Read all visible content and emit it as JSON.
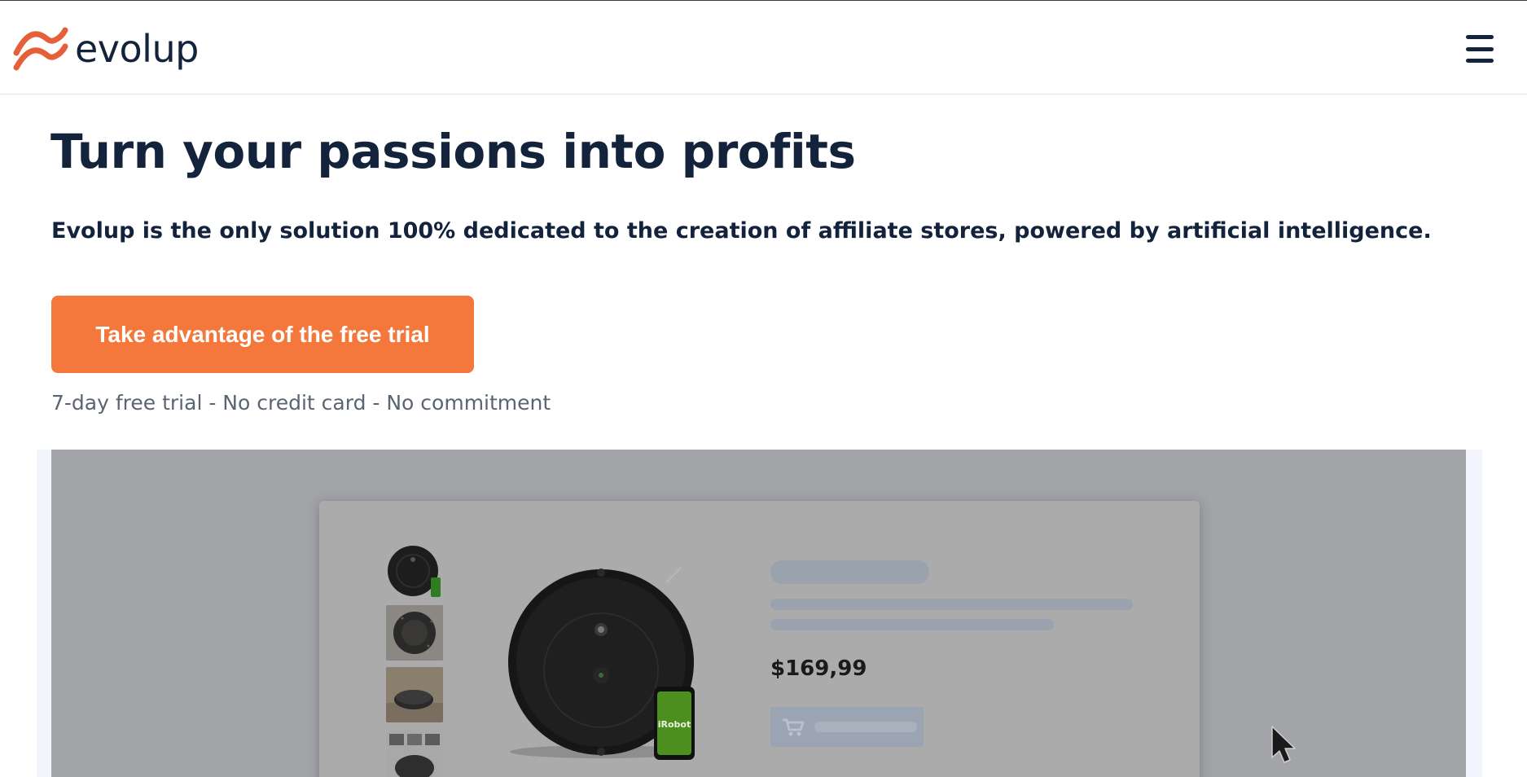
{
  "header": {
    "logo_text": "evolup",
    "logo_icon": "evolup-logo-icon",
    "menu_icon": "hamburger-menu-icon",
    "brand_colors": {
      "logo_orange": "#e5603a",
      "navy": "#14233c"
    }
  },
  "hero": {
    "title": "Turn your passions into profits",
    "subtitle": "Evolup is the only solution 100% dedicated to the creation of affiliate stores, powered by artificial intelligence.",
    "cta_label": "Take advantage of the free trial",
    "cta_color": "#f4783c",
    "trial_note": "7-day free trial - No credit card - No commitment"
  },
  "demo": {
    "product_image_icon": "robot-vacuum-image",
    "phone_label": "iRobot",
    "price": "$169,99",
    "cart_icon": "cart-icon",
    "thumbnail_count": 4
  },
  "cursor_icon": "mouse-pointer-icon"
}
